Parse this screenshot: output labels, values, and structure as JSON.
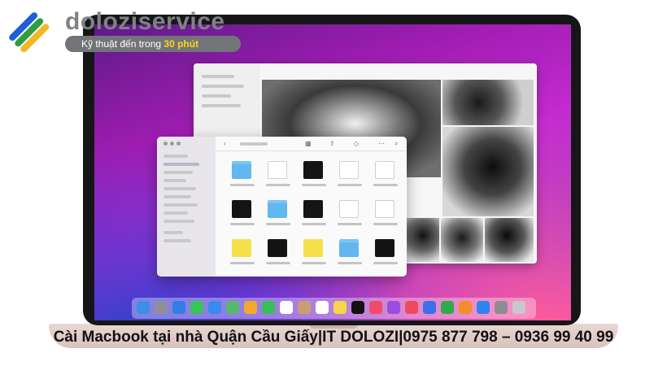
{
  "brand": {
    "name": "doloziservice",
    "tagline_prefix": "Kỹ thuật đến trong",
    "tagline_highlight": "30 phút",
    "colors": {
      "text_gray": "#7f8184",
      "pill": "#727477",
      "highlight": "#ffd21f"
    },
    "logo_stripes": [
      "#1e5fd6",
      "#2d9e44",
      "#f2b824"
    ]
  },
  "caption": "Cài Macbook tại nhà Quận Cầu Giấy|IT DOLOZI|0975 877 798 – 0936 99 40 99",
  "finder": {
    "thumbnails": [
      {
        "icon": "folder-icon"
      },
      {
        "icon": "image-icon"
      },
      {
        "icon": "photo-icon"
      },
      {
        "icon": "document-icon"
      },
      {
        "icon": "image-icon"
      },
      {
        "icon": "photo-icon"
      },
      {
        "icon": "folder-icon"
      },
      {
        "icon": "photo-icon"
      },
      {
        "icon": "image-icon"
      },
      {
        "icon": "document-icon"
      },
      {
        "icon": "image-icon"
      },
      {
        "icon": "photo-icon"
      },
      {
        "icon": "image-icon"
      },
      {
        "icon": "folder-icon"
      },
      {
        "icon": "photo-icon"
      }
    ]
  },
  "dock": {
    "icons": [
      "finder-icon",
      "launchpad-icon",
      "safari-icon",
      "messages-icon",
      "mail-icon",
      "maps-icon",
      "photos-icon",
      "facetime-icon",
      "calendar-icon",
      "contacts-icon",
      "reminders-icon",
      "notes-icon",
      "tv-icon",
      "music-icon",
      "podcasts-icon",
      "news-icon",
      "keynote-icon",
      "numbers-icon",
      "pages-icon",
      "app-store-icon",
      "settings-icon",
      "trash-icon"
    ],
    "colors": [
      "#3d8ee8",
      "#8f8f9a",
      "#2f7fe6",
      "#37c45a",
      "#3b8af0",
      "#55b96b",
      "#f0a92c",
      "#36c05c",
      "#ffffff",
      "#c99d73",
      "#ffffff",
      "#f6d54a",
      "#111111",
      "#f04b6a",
      "#9a4ee0",
      "#ef4a5b",
      "#3e6ee8",
      "#2faa4e",
      "#f08f2c",
      "#2e84f0",
      "#8c8c92",
      "#c8c8cc"
    ]
  }
}
